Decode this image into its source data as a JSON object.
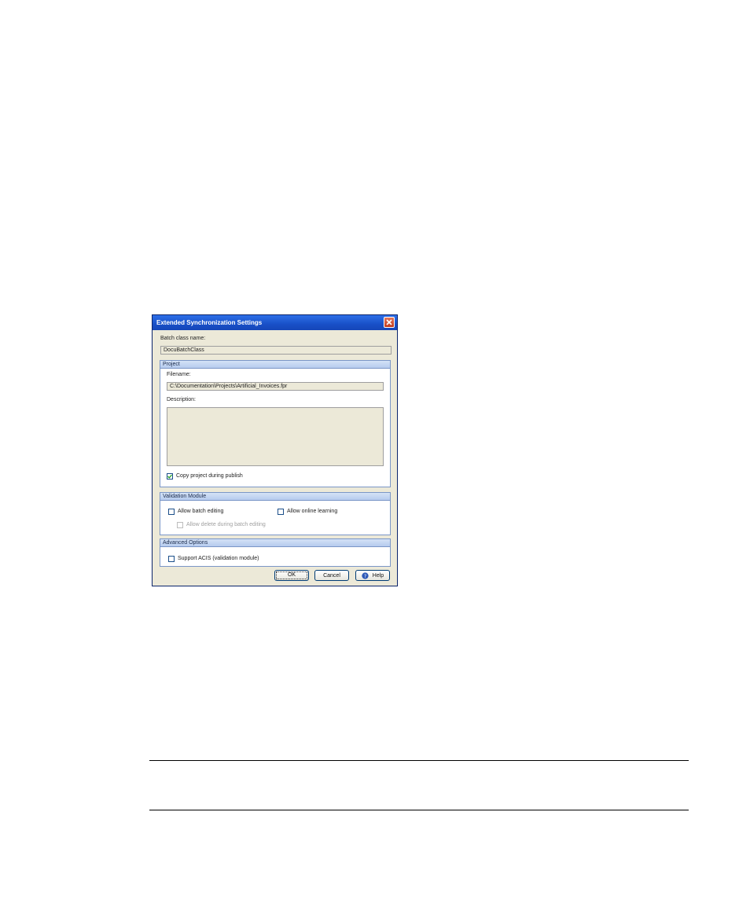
{
  "dialog": {
    "title": "Extended Synchronization Settings",
    "batch_class_label": "Batch class name:",
    "batch_class_value": "DocuBatchClass"
  },
  "project": {
    "header": "Project",
    "filename_label": "Filename:",
    "filename_value": "C:\\Documentation\\Projects\\Artificial_Invoices.fpr",
    "description_label": "Description:",
    "description_value": "",
    "copy_label": "Copy project during publish",
    "copy_checked": true
  },
  "validation": {
    "header": "Validation Module",
    "batch_editing_label": "Allow batch editing",
    "online_learning_label": "Allow online learning",
    "delete_label": "Allow delete during batch editing"
  },
  "advanced": {
    "header": "Advanced Options",
    "acis_label": "Support ACIS (validation module)"
  },
  "buttons": {
    "ok": "OK",
    "cancel": "Cancel",
    "help": "Help"
  },
  "colors": {
    "titlebar": "#1950c7",
    "dialog_bg": "#ece9d8",
    "group_header": "#c3d5f2"
  }
}
